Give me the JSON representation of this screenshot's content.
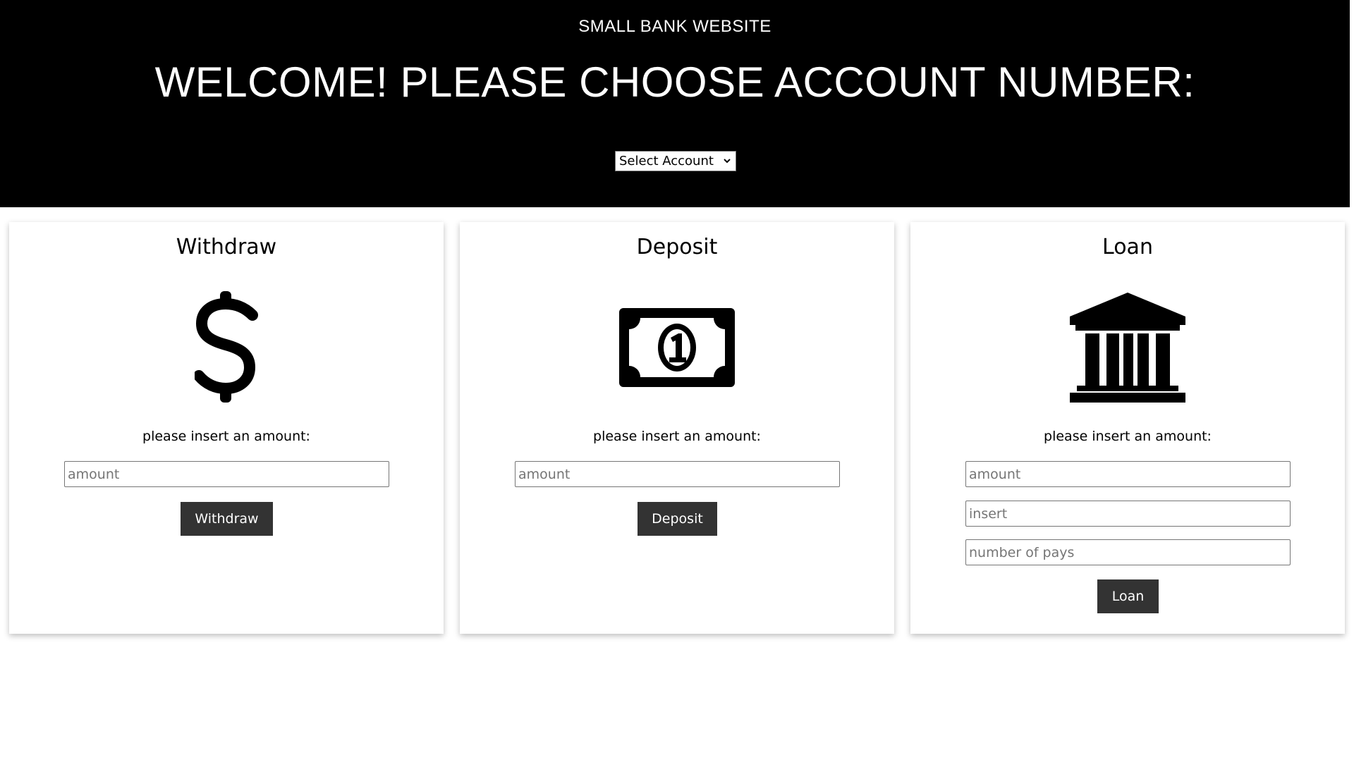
{
  "header": {
    "site_title": "SMALL BANK WEBSITE",
    "welcome": "WELCOME! PLEASE CHOOSE ACCOUNT NUMBER:",
    "account_select": "Select Account"
  },
  "cards": {
    "withdraw": {
      "title": "Withdraw",
      "icon": "dollar-sign-icon",
      "prompt": "please insert an amount:",
      "amount_placeholder": "amount",
      "button": "Withdraw"
    },
    "deposit": {
      "title": "Deposit",
      "icon": "money-bill-icon",
      "prompt": "please insert an amount:",
      "amount_placeholder": "amount",
      "button": "Deposit"
    },
    "loan": {
      "title": "Loan",
      "icon": "bank-building-icon",
      "prompt": "please insert an amount:",
      "amount_placeholder": "amount",
      "insert_placeholder": "insert",
      "pays_placeholder": "number of pays",
      "button": "Loan"
    }
  },
  "colors": {
    "header_bg": "#000000",
    "header_text": "#ffffff",
    "button_bg": "#333333",
    "button_text": "#ffffff"
  }
}
